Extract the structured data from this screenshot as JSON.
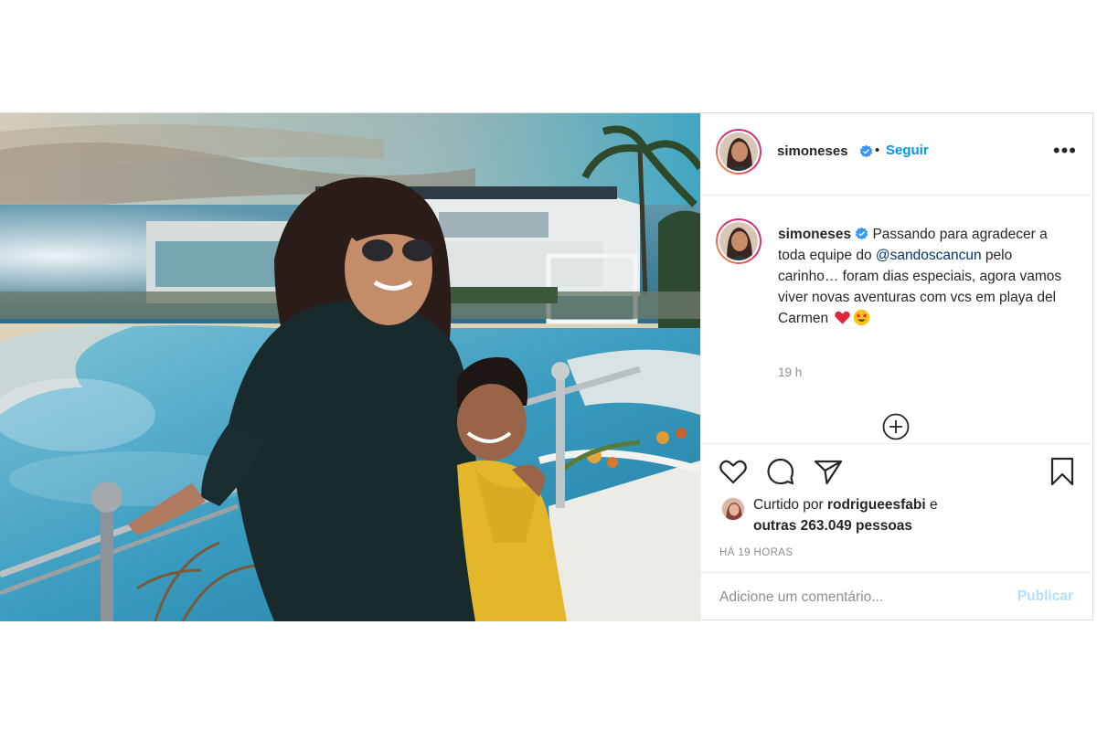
{
  "post": {
    "photo_alt": "",
    "colors": {
      "accent": "#0095f6",
      "mention": "#00376b",
      "muted": "#8e8e8e",
      "heart": "#ed4956"
    }
  },
  "header": {
    "username": "simoneses",
    "separator": "•",
    "follow_label": "Seguir",
    "more_label": "•••",
    "avatar_icon": "profile-avatar",
    "verified_icon": "verified-badge-icon"
  },
  "caption": {
    "username": "simoneses",
    "text_before_mention": "Passando para agradecer a toda equipe do ",
    "mention": "@sandoscancun",
    "text_after_mention": " pelo carinho… foram dias especiais, agora vamos viver novas aventuras com vcs em playa del Carmen",
    "emojis": [
      "red-heart-emoji",
      "star-struck-emoji"
    ],
    "timestamp": "19 h",
    "load_more_icon": "plus-circle-icon"
  },
  "actions": {
    "icons": [
      "heart-icon",
      "comment-icon",
      "share-icon",
      "bookmark-icon"
    ]
  },
  "likes": {
    "prefix": "Curtido por",
    "liker": "rodrigueesfabi",
    "connector": "e",
    "others": "outras 263.049 pessoas"
  },
  "time_ago": "HÁ 19 HORAS",
  "comment": {
    "placeholder": "Adicione um comentário...",
    "publish_label": "Publicar"
  }
}
